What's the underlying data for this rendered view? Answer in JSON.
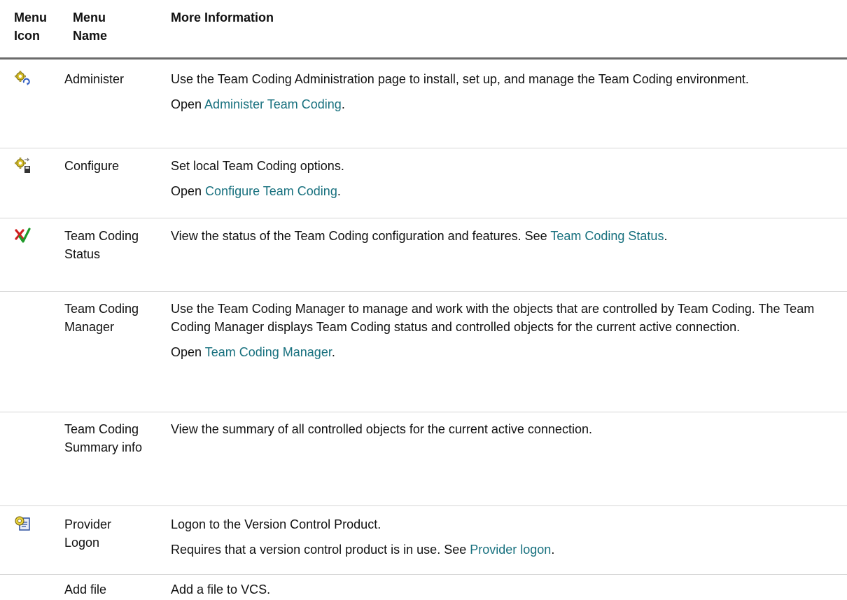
{
  "headers": {
    "icon_line1": "Menu",
    "icon_line2": "Icon",
    "name_line1": "Menu",
    "name_line2": "Name",
    "info": "More Information"
  },
  "rows": [
    {
      "icon": "gear-refresh-icon",
      "name": "Administer",
      "p1": "Use the Team Coding Administration page to install, set up, and manage the Team Coding environment.",
      "p2_prefix": "Open ",
      "p2_link": "Administer Team Coding",
      "p2_suffix": "."
    },
    {
      "icon": "gear-disk-icon",
      "name": "Configure",
      "p1": "Set local Team Coding options.",
      "p2_prefix": "Open ",
      "p2_link": "Configure Team Coding",
      "p2_suffix": "."
    },
    {
      "icon": "x-check-icon",
      "name": "Team Coding Status",
      "p1_prefix": "View the status of the Team Coding configuration and features. See ",
      "p1_link": "Team Coding Status",
      "p1_suffix": "."
    },
    {
      "icon": "",
      "name": "Team Coding Manager",
      "p1": "Use the Team Coding Manager to manage and work with the objects that are controlled by Team Coding. The Team Coding Manager displays Team Coding status and controlled objects for the current active connection.",
      "p2_prefix": "Open ",
      "p2_link": "Team Coding Manager",
      "p2_suffix": "."
    },
    {
      "icon": "",
      "name": "Team Coding Summary info",
      "p1": "View the summary of all controlled objects for the current active connection."
    },
    {
      "icon": "provider-logon-icon",
      "name": "Provider Logon",
      "p1": "Logon to the Version Control Product.",
      "p2_prefix": "Requires that a version control product is in use. See ",
      "p2_link": "Provider logon",
      "p2_suffix": "."
    },
    {
      "icon": "",
      "name": "Add file",
      "p1": "Add a file to VCS."
    }
  ],
  "colors": {
    "link": "#17707e",
    "header_rule": "#6b6b6b",
    "row_rule": "#d6d6d6"
  }
}
